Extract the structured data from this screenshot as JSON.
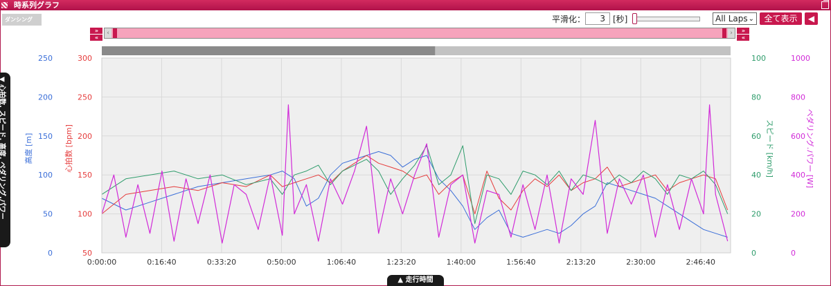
{
  "window": {
    "title": "時系列グラフ"
  },
  "logo_text": "ダンシング",
  "controls": {
    "smoothing_label": "平滑化：",
    "smoothing_value": "3",
    "smoothing_unit": "[秒]",
    "laps_selected": "All Laps",
    "show_all_label": "全て表示",
    "back_icon": "arrow-left-icon",
    "nav_right": "»",
    "nav_left": "«"
  },
  "side_tab_label": "▼ 心拍数, スピード, 高度, ペダリング.パワー",
  "bottom_tab_label": "▲ 走行時間",
  "chart_data": {
    "type": "line",
    "x_unit": "elapsed time",
    "x_ticks": [
      "0:00:00",
      "0:16:40",
      "0:33:20",
      "0:50:00",
      "1:06:40",
      "1:23:20",
      "1:40:00",
      "1:56:40",
      "2:13:20",
      "2:30:00",
      "2:46:40"
    ],
    "x_range_seconds": [
      0,
      10450
    ],
    "grid": true,
    "overview_bar_fraction": 0.53,
    "axes": [
      {
        "id": "altitude",
        "label": "高度 [m]",
        "color": "#3a6ed8",
        "side": "left",
        "outer": true,
        "range": [
          0,
          250
        ],
        "ticks": [
          0,
          50,
          100,
          150,
          200,
          250
        ]
      },
      {
        "id": "heart_rate",
        "label": "心拍数 [bpm]",
        "color": "#e53b3b",
        "side": "left",
        "outer": false,
        "range": [
          50,
          300
        ],
        "ticks": [
          50,
          100,
          150,
          200,
          250,
          300
        ]
      },
      {
        "id": "speed",
        "label": "スピード [km/h]",
        "color": "#2e9c6b",
        "side": "right",
        "outer": false,
        "range": [
          0,
          100
        ],
        "ticks": [
          0,
          20,
          40,
          60,
          80,
          100
        ]
      },
      {
        "id": "power",
        "label": "ペダリング.パワー [W]",
        "color": "#d12ad8",
        "side": "right",
        "outer": true,
        "range": [
          0,
          1000
        ],
        "ticks": [
          0,
          200,
          400,
          600,
          800,
          1000
        ]
      }
    ],
    "series": [
      {
        "axis": "altitude",
        "color": "#3a6ed8",
        "x": [
          0,
          400,
          800,
          1200,
          1600,
          2000,
          2400,
          2800,
          3000,
          3200,
          3400,
          3600,
          3800,
          4000,
          4200,
          4400,
          4600,
          4800,
          5000,
          5200,
          5400,
          5600,
          5800,
          6000,
          6200,
          6400,
          6600,
          6800,
          7000,
          7200,
          7400,
          7600,
          7800,
          8000,
          8200,
          8400,
          8600,
          8800,
          9000,
          9200,
          9400,
          9600,
          9800,
          10000,
          10200,
          10400
        ],
        "values": [
          70,
          55,
          65,
          75,
          85,
          90,
          95,
          100,
          105,
          95,
          60,
          70,
          100,
          115,
          120,
          125,
          130,
          125,
          110,
          120,
          125,
          95,
          80,
          60,
          30,
          45,
          55,
          25,
          20,
          25,
          30,
          25,
          35,
          50,
          60,
          90,
          85,
          80,
          75,
          70,
          60,
          50,
          40,
          30,
          25,
          20
        ]
      },
      {
        "axis": "heart_rate",
        "color": "#e53b3b",
        "x": [
          0,
          400,
          800,
          1200,
          1600,
          2000,
          2400,
          2800,
          3000,
          3200,
          3400,
          3600,
          3800,
          4000,
          4200,
          4400,
          4600,
          4800,
          5000,
          5200,
          5400,
          5600,
          5800,
          6000,
          6200,
          6400,
          6600,
          6800,
          7000,
          7200,
          7400,
          7600,
          7800,
          8000,
          8200,
          8400,
          8600,
          8800,
          9000,
          9200,
          9400,
          9600,
          9800,
          10000,
          10200,
          10400
        ],
        "values": [
          100,
          125,
          130,
          135,
          130,
          140,
          135,
          150,
          135,
          140,
          145,
          150,
          140,
          155,
          165,
          175,
          165,
          160,
          155,
          145,
          150,
          125,
          140,
          150,
          100,
          155,
          120,
          105,
          130,
          145,
          135,
          150,
          130,
          140,
          145,
          160,
          135,
          140,
          145,
          150,
          130,
          140,
          145,
          150,
          145,
          105
        ]
      },
      {
        "axis": "speed",
        "color": "#2e9c6b",
        "x": [
          0,
          400,
          800,
          1200,
          1600,
          2000,
          2400,
          2800,
          3000,
          3200,
          3400,
          3600,
          3800,
          4000,
          4200,
          4400,
          4600,
          4800,
          5000,
          5200,
          5400,
          5600,
          5800,
          6000,
          6200,
          6400,
          6600,
          6800,
          7000,
          7200,
          7400,
          7600,
          7800,
          8000,
          8200,
          8400,
          8600,
          8800,
          9000,
          9200,
          9400,
          9600,
          9800,
          10000,
          10200,
          10400
        ],
        "values": [
          30,
          38,
          40,
          42,
          38,
          40,
          35,
          38,
          30,
          40,
          42,
          45,
          35,
          42,
          45,
          48,
          42,
          30,
          38,
          45,
          55,
          35,
          40,
          55,
          15,
          40,
          38,
          30,
          42,
          40,
          35,
          42,
          32,
          40,
          38,
          35,
          40,
          36,
          42,
          38,
          30,
          40,
          38,
          42,
          35,
          20
        ]
      },
      {
        "axis": "power",
        "color": "#d12ad8",
        "x": [
          0,
          200,
          400,
          600,
          800,
          1000,
          1200,
          1400,
          1600,
          1800,
          2000,
          2200,
          2400,
          2600,
          2800,
          3000,
          3100,
          3200,
          3400,
          3600,
          3800,
          4000,
          4200,
          4400,
          4600,
          4800,
          5000,
          5200,
          5400,
          5600,
          5800,
          6000,
          6200,
          6400,
          6600,
          6800,
          7000,
          7200,
          7400,
          7600,
          7800,
          8000,
          8200,
          8400,
          8600,
          8800,
          9000,
          9200,
          9400,
          9600,
          9800,
          10000,
          10100,
          10200,
          10400
        ],
        "values": [
          200,
          400,
          80,
          350,
          100,
          420,
          60,
          380,
          150,
          400,
          50,
          350,
          300,
          120,
          400,
          90,
          760,
          200,
          350,
          60,
          380,
          250,
          420,
          650,
          100,
          380,
          200,
          400,
          560,
          80,
          350,
          400,
          50,
          320,
          300,
          80,
          350,
          120,
          400,
          50,
          380,
          300,
          680,
          100,
          380,
          250,
          400,
          80,
          350,
          120,
          380,
          200,
          760,
          300,
          60
        ]
      }
    ]
  }
}
